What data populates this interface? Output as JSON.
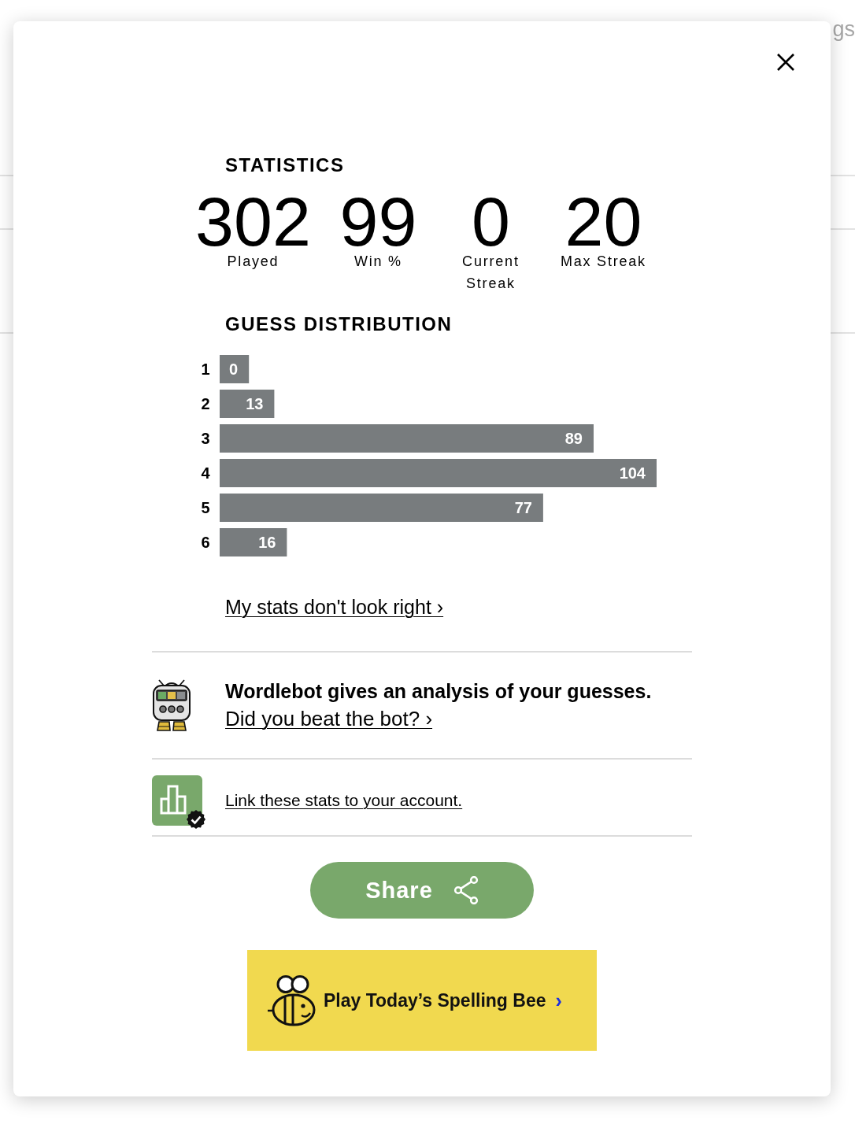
{
  "background": {
    "text_fragment": "gs"
  },
  "modal": {
    "statistics": {
      "title": "STATISTICS",
      "items": [
        {
          "value": "302",
          "label": "Played"
        },
        {
          "value": "99",
          "label": "Win %"
        },
        {
          "value": "0",
          "label": "Current Streak"
        },
        {
          "value": "20",
          "label": "Max Streak"
        }
      ]
    },
    "guess_distribution": {
      "title": "GUESS DISTRIBUTION",
      "chart_data": {
        "type": "bar",
        "orientation": "horizontal",
        "categories": [
          "1",
          "2",
          "3",
          "4",
          "5",
          "6"
        ],
        "values": [
          0,
          13,
          89,
          104,
          77,
          16
        ],
        "data_labels": true
      }
    },
    "stats_link": "My stats don't look right ›",
    "promos": [
      {
        "kind": "wordlebot",
        "heading": "Wordlebot gives an analysis of your guesses.",
        "link": "Did you beat the bot? ›"
      },
      {
        "kind": "account",
        "link": "Link these stats to your account."
      }
    ],
    "share_button": {
      "label": "Share"
    },
    "spelling_bee_banner": {
      "label": "Play Today’s Spelling Bee",
      "arrow": "›"
    }
  }
}
